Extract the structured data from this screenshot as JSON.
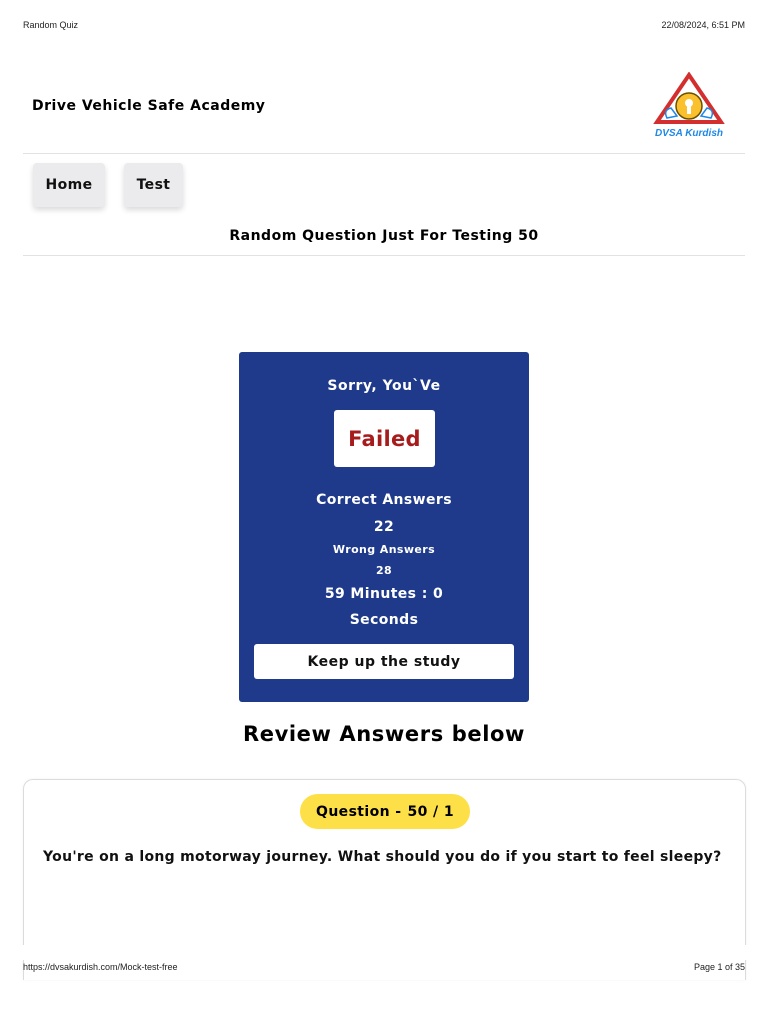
{
  "print_header": {
    "left": "Random Quiz",
    "right": "22/08/2024, 6:51 PM"
  },
  "site": {
    "title": "Drive Vehicle Safe Academy",
    "logo_text": "DVSA Kurdish"
  },
  "nav": {
    "home": "Home",
    "test": "Test"
  },
  "quiz_title": "Random Question Just For Testing 50",
  "result": {
    "heading": "Sorry, You`Ve",
    "status": "Failed",
    "correct_label": "Correct Answers",
    "correct_value": "22",
    "wrong_label": "Wrong Answers",
    "wrong_value": "28",
    "time_line1": "59 Minutes : 0",
    "time_line2": "Seconds",
    "button": "Keep up the study"
  },
  "review_heading": "Review Answers below",
  "question": {
    "label": "Question -",
    "number": "50 / 1",
    "text": "You're on a long motorway journey. What should you do if you start to feel sleepy?"
  },
  "print_footer": {
    "url": "https://dvsakurdish.com/Mock-test-free",
    "page": "Page 1 of 35"
  },
  "colors": {
    "card_blue": "#1f3a8a",
    "failed_red": "#a61b1b",
    "pill_yellow": "#fde047",
    "logo_blue": "#1e88e5",
    "logo_red": "#d32f2f",
    "logo_yellow": "#fbc02d"
  },
  "icons": {
    "logo": "dvsa-kurdish-logo"
  }
}
